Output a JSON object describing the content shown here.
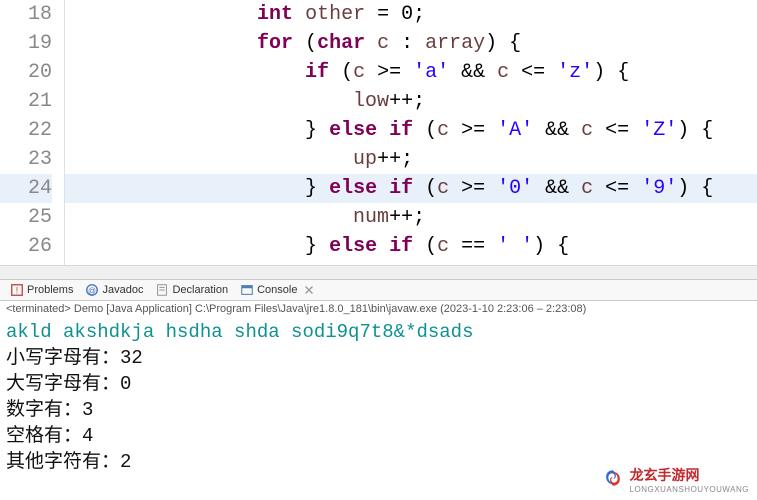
{
  "editor": {
    "lines": [
      {
        "n": 18,
        "indent": 4,
        "hl": false,
        "tokens": [
          {
            "t": "kw",
            "s": "int"
          },
          {
            "t": "pn",
            "s": " "
          },
          {
            "t": "var",
            "s": "other"
          },
          {
            "t": "pn",
            "s": " = 0;"
          }
        ]
      },
      {
        "n": 19,
        "indent": 4,
        "hl": false,
        "tokens": [
          {
            "t": "kw",
            "s": "for"
          },
          {
            "t": "pn",
            "s": " ("
          },
          {
            "t": "kw",
            "s": "char"
          },
          {
            "t": "pn",
            "s": " "
          },
          {
            "t": "var",
            "s": "c"
          },
          {
            "t": "pn",
            "s": " : "
          },
          {
            "t": "var",
            "s": "array"
          },
          {
            "t": "pn",
            "s": ") {"
          }
        ]
      },
      {
        "n": 20,
        "indent": 5,
        "hl": false,
        "tokens": [
          {
            "t": "kw",
            "s": "if"
          },
          {
            "t": "pn",
            "s": " ("
          },
          {
            "t": "var",
            "s": "c"
          },
          {
            "t": "pn",
            "s": " >= "
          },
          {
            "t": "str",
            "s": "'a'"
          },
          {
            "t": "pn",
            "s": " && "
          },
          {
            "t": "var",
            "s": "c"
          },
          {
            "t": "pn",
            "s": " <= "
          },
          {
            "t": "str",
            "s": "'z'"
          },
          {
            "t": "pn",
            "s": ") {"
          }
        ]
      },
      {
        "n": 21,
        "indent": 6,
        "hl": false,
        "tokens": [
          {
            "t": "var",
            "s": "low"
          },
          {
            "t": "pn",
            "s": "++;"
          }
        ]
      },
      {
        "n": 22,
        "indent": 5,
        "hl": false,
        "tokens": [
          {
            "t": "pn",
            "s": "} "
          },
          {
            "t": "kw",
            "s": "else if"
          },
          {
            "t": "pn",
            "s": " ("
          },
          {
            "t": "var",
            "s": "c"
          },
          {
            "t": "pn",
            "s": " >= "
          },
          {
            "t": "str",
            "s": "'A'"
          },
          {
            "t": "pn",
            "s": " && "
          },
          {
            "t": "var",
            "s": "c"
          },
          {
            "t": "pn",
            "s": " <= "
          },
          {
            "t": "str",
            "s": "'Z'"
          },
          {
            "t": "pn",
            "s": ") {"
          }
        ]
      },
      {
        "n": 23,
        "indent": 6,
        "hl": false,
        "tokens": [
          {
            "t": "var",
            "s": "up"
          },
          {
            "t": "pn",
            "s": "++;"
          }
        ]
      },
      {
        "n": 24,
        "indent": 5,
        "hl": true,
        "tokens": [
          {
            "t": "pn",
            "s": "} "
          },
          {
            "t": "kw",
            "s": "else if"
          },
          {
            "t": "pn",
            "s": " ("
          },
          {
            "t": "var",
            "s": "c"
          },
          {
            "t": "pn",
            "s": " >= "
          },
          {
            "t": "str",
            "s": "'0'"
          },
          {
            "t": "pn",
            "s": " && "
          },
          {
            "t": "var",
            "s": "c"
          },
          {
            "t": "pn",
            "s": " <= "
          },
          {
            "t": "str",
            "s": "'9'"
          },
          {
            "t": "pn",
            "s": ") {"
          }
        ]
      },
      {
        "n": 25,
        "indent": 6,
        "hl": false,
        "tokens": [
          {
            "t": "var",
            "s": "num"
          },
          {
            "t": "pn",
            "s": "++;"
          }
        ]
      },
      {
        "n": 26,
        "indent": 5,
        "hl": false,
        "tokens": [
          {
            "t": "pn",
            "s": "} "
          },
          {
            "t": "kw",
            "s": "else if"
          },
          {
            "t": "pn",
            "s": " ("
          },
          {
            "t": "var",
            "s": "c"
          },
          {
            "t": "pn",
            "s": " == "
          },
          {
            "t": "str",
            "s": "' '"
          },
          {
            "t": "pn",
            "s": ") {"
          }
        ]
      }
    ]
  },
  "tabs": {
    "problems": "Problems",
    "javadoc": "Javadoc",
    "declaration": "Declaration",
    "console": "Console"
  },
  "terminated_line": "<terminated> Demo [Java Application] C:\\Program Files\\Java\\jre1.8.0_181\\bin\\javaw.exe  (2023-1-10 2:23:06 – 2:23:08)",
  "console": {
    "input": "akld akshdkja hsdha shda sodi9q7t8&*dsads",
    "lines": [
      "小写字母有：32",
      "大写字母有：0",
      "数字有：3",
      "空格有：4",
      "其他字符有：2"
    ]
  },
  "watermark": {
    "name": "龙玄手游网",
    "sub": "LONGXUANSHOUYOUWANG"
  }
}
